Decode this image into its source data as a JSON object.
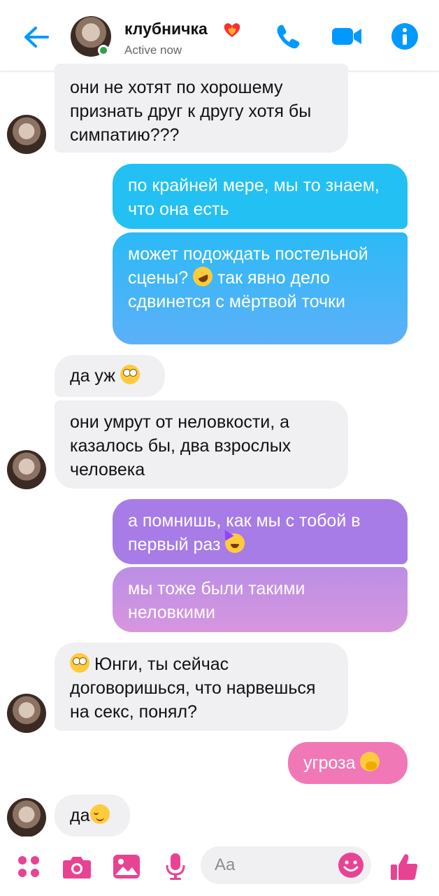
{
  "header": {
    "name": "клубничка",
    "status": "Active now",
    "colors": {
      "accent": "#0099ff",
      "online": "#31a24c"
    },
    "icons": [
      "back-arrow-icon",
      "phone-icon",
      "video-camera-icon",
      "info-icon"
    ]
  },
  "messages": [
    {
      "id": 1,
      "from": "them",
      "text": "они не хотят по хорошему признать друг к другу хотя бы симпатию???"
    },
    {
      "id": 2,
      "from": "me",
      "text": "по крайней мере, мы то знаем, что она есть"
    },
    {
      "id": 3,
      "from": "me",
      "text_before": "может подождать постельной сцены?",
      "emoji": "rolling-on-floor-laughing-emoji",
      "text_after": "так явно дело сдвинется с мёртвой точки"
    },
    {
      "id": 4,
      "from": "them",
      "text": "да уж",
      "emoji": "eye-roll-emoji"
    },
    {
      "id": 5,
      "from": "them",
      "text": "они умрут от неловкости, а казалось бы, два взрослых человека"
    },
    {
      "id": 6,
      "from": "me",
      "text": "а помнишь, как мы с тобой в первый раз",
      "emoji": "partying-face-emoji"
    },
    {
      "id": 7,
      "from": "me",
      "text": "мы тоже были такими неловкими"
    },
    {
      "id": 8,
      "from": "them",
      "emoji": "eye-roll-emoji",
      "text": "Юнги, ты сейчас договоришься, что нарвешься на секс, понял?"
    },
    {
      "id": 9,
      "from": "me",
      "text": "угроза",
      "emoji": "face-with-hand-over-mouth-emoji"
    },
    {
      "id": 10,
      "from": "them",
      "text": "да",
      "emoji": "relieved-face-emoji"
    }
  ],
  "composer": {
    "placeholder": "Aa",
    "icons": [
      "more-icon",
      "camera-icon",
      "gallery-icon",
      "microphone-icon",
      "emoji-icon",
      "like-icon"
    ],
    "accent": "#e84393"
  }
}
